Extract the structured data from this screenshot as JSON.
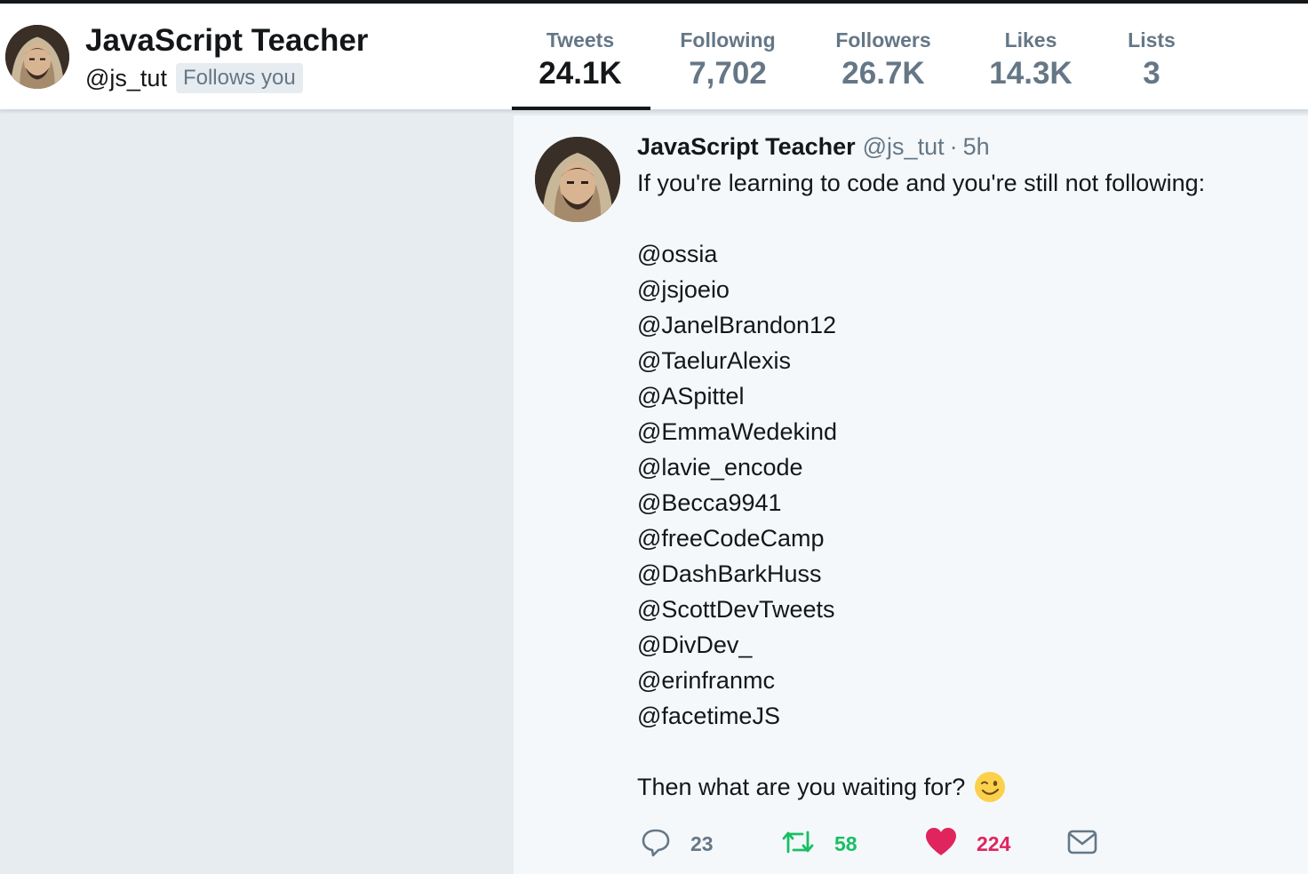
{
  "profile": {
    "name": "JavaScript Teacher",
    "handle": "@js_tut",
    "follows_badge": "Follows you"
  },
  "stats": [
    {
      "label": "Tweets",
      "value": "24.1K",
      "active": true
    },
    {
      "label": "Following",
      "value": "7,702"
    },
    {
      "label": "Followers",
      "value": "26.7K"
    },
    {
      "label": "Likes",
      "value": "14.3K"
    },
    {
      "label": "Lists",
      "value": "3"
    }
  ],
  "tweet": {
    "author": "JavaScript Teacher",
    "handle": "@js_tut",
    "separator": "·",
    "time": "5h",
    "intro": "If you're learning to code and you're still not following:",
    "mentions": [
      "@ossia",
      "@jsjoeio",
      "@JanelBrandon12",
      "@TaelurAlexis",
      "@ASpittel",
      "@EmmaWedekind",
      "@lavie_encode",
      "@Becca9941",
      "@freeCodeCamp",
      "@DashBarkHuss",
      "@ScottDevTweets",
      "@DivDev_",
      "@erinfranmc",
      "@facetimeJS"
    ],
    "outro": "Then what are you waiting for?",
    "emoji": "winking-face-emoji"
  },
  "actions": {
    "reply_count": "23",
    "retweet_count": "58",
    "like_count": "224"
  },
  "icons": {
    "reply": "speech-bubble-icon",
    "retweet": "retweet-arrows-icon",
    "like": "heart-icon",
    "dm": "envelope-icon"
  },
  "colors": {
    "text": "#14171a",
    "secondary": "#657786",
    "retweet": "#17bf63",
    "like": "#e0245e",
    "background": "#e6ecf0",
    "feed": "#f5f8fa"
  }
}
